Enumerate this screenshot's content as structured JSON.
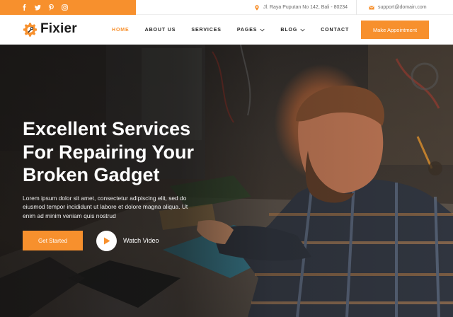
{
  "colors": {
    "accent": "#f7902d",
    "text_dark": "#1b1b1b",
    "white": "#ffffff"
  },
  "topbar": {
    "social": [
      {
        "icon": "facebook-icon"
      },
      {
        "icon": "twitter-icon"
      },
      {
        "icon": "pinterest-icon"
      },
      {
        "icon": "instagram-icon"
      }
    ],
    "address": {
      "icon": "map-pin-icon",
      "text": "Jl. Raya Puputan No 142, Bali - 80234"
    },
    "email": {
      "icon": "mail-icon",
      "text": "support@domain.com"
    }
  },
  "header": {
    "logo": {
      "icon": "gear-icon",
      "text": "Fixier"
    },
    "nav": [
      {
        "label": "HOME",
        "active": true
      },
      {
        "label": "ABOUT US"
      },
      {
        "label": "SERVICES"
      },
      {
        "label": "PAGES",
        "dropdown": true
      },
      {
        "label": "BLOG",
        "dropdown": true
      },
      {
        "label": "CONTACT"
      }
    ],
    "cta": "Make Appointment"
  },
  "hero": {
    "title_lines": [
      "Excellent Services",
      "For Repairing Your",
      "Broken Gadget"
    ],
    "text": "Lorem ipsum dolor sit amet, consectetur adipiscing elit, sed do eiusmod tempor incididunt ut labore et dolore magna aliqua. Ut enim ad minim veniam quis nostrud",
    "primary_button": "Get Started",
    "video_button": "Watch Video"
  }
}
